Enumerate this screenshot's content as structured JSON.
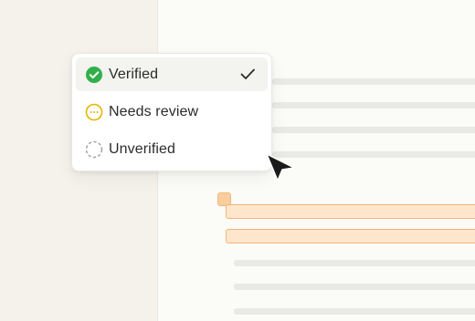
{
  "status_menu": {
    "items": [
      {
        "label": "Verified",
        "icon": "check-circle-filled-icon",
        "selected": true
      },
      {
        "label": "Needs review",
        "icon": "dots-circle-icon",
        "selected": false
      },
      {
        "label": "Unverified",
        "icon": "dashed-circle-icon",
        "selected": false
      }
    ]
  },
  "colors": {
    "verified_green": "#31b04a",
    "needs_review_yellow": "#e6b400",
    "unverified_gray": "#a3a3a3",
    "highlight_fill": "#fde6cc",
    "highlight_border": "#f4b478"
  }
}
